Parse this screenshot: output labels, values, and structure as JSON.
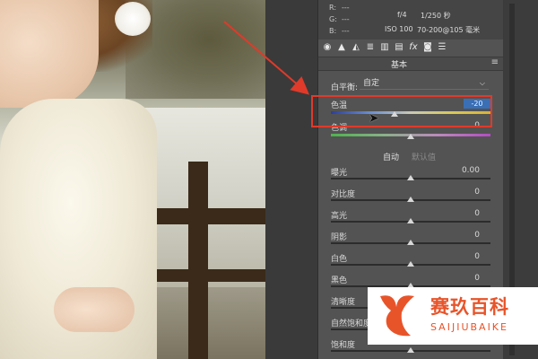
{
  "info": {
    "r_label": "R:",
    "r_value": "---",
    "g_label": "G:",
    "g_value": "---",
    "b_label": "B:",
    "b_value": "---",
    "aperture": "f/4",
    "shutter": "1/250 秒",
    "iso": "ISO 100",
    "lens": "70-200@105 毫米"
  },
  "tools": [
    "camera-icon",
    "mountain-icon",
    "mountain-split-icon",
    "stack-icon",
    "levels-icon",
    "film-icon",
    "fx-icon",
    "photo-icon",
    "sliders-icon"
  ],
  "section": {
    "title": "基本",
    "menu": "≡"
  },
  "white_balance": {
    "label": "白平衡:",
    "value": "自定",
    "arrow": "⌵"
  },
  "temperature": {
    "label": "色温",
    "value": "-20",
    "level": -20
  },
  "tint": {
    "label": "色调",
    "value": "0",
    "level": 0
  },
  "auto_label": "自动",
  "default_label": "默认值",
  "adjustments": [
    {
      "label": "曝光",
      "value": "0.00"
    },
    {
      "label": "对比度",
      "value": "0"
    },
    {
      "label": "高光",
      "value": "0"
    },
    {
      "label": "阴影",
      "value": "0"
    },
    {
      "label": "白色",
      "value": "0"
    },
    {
      "label": "黑色",
      "value": "0"
    },
    {
      "label": "清晰度",
      "value": ""
    },
    {
      "label": "自然饱和度",
      "value": ""
    },
    {
      "label": "饱和度",
      "value": ""
    }
  ],
  "colors": {
    "highlight": "#e03a2a",
    "selection": "#3a6fb6",
    "brand": "#e8542a"
  },
  "watermark": {
    "name": "赛玖百科",
    "pinyin": "SAIJIUBAIKE"
  }
}
